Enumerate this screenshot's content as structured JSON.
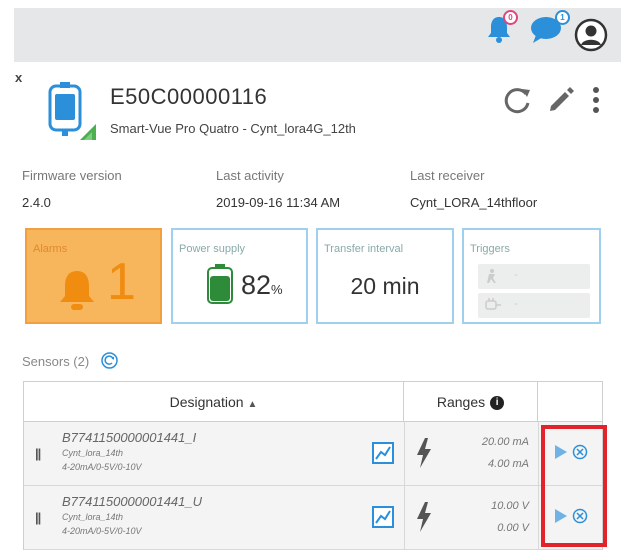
{
  "topbar": {
    "notifications_badge": "0",
    "messages_badge": "1",
    "colors": {
      "bell": "#2b8fd9",
      "chat": "#2b8fd9",
      "bar": "#e6e7e8"
    }
  },
  "close_symbol": "x",
  "device": {
    "id": "E50C00000116",
    "subtitle": "Smart-Vue Pro Quatro - Cynt_lora4G_12th",
    "icon": "device-tag-icon"
  },
  "info": {
    "firmware_label": "Firmware version",
    "firmware_value": "2.4.0",
    "activity_label": "Last activity",
    "activity_value": "2019-09-16 11:34 AM",
    "receiver_label": "Last receiver",
    "receiver_value": "Cynt_LORA_14thfloor"
  },
  "tiles": {
    "alarms_label": "Alarms",
    "alarms_count": "1",
    "power_label": "Power supply",
    "power_value": "82",
    "power_unit": "%",
    "power_level": 0.82,
    "transfer_label": "Transfer interval",
    "transfer_value": "20 min",
    "triggers_label": "Triggers",
    "trigger_1_value": "-",
    "trigger_2_value": "-"
  },
  "sensors": {
    "label": "Sensors (2)",
    "col_designation": "Designation",
    "col_ranges": "Ranges",
    "rows": [
      {
        "name": "B7741150000001441_I",
        "place": "Cynt_lora_14th",
        "range_type": "4-20mA/0-5V/0-10V",
        "high": "20.00 mA",
        "low": "4.00 mA"
      },
      {
        "name": "B7741150000001441_U",
        "place": "Cynt_lora_14th",
        "range_type": "4-20mA/0-5V/0-10V",
        "high": "10.00 V",
        "low": "0.00 V"
      }
    ]
  }
}
